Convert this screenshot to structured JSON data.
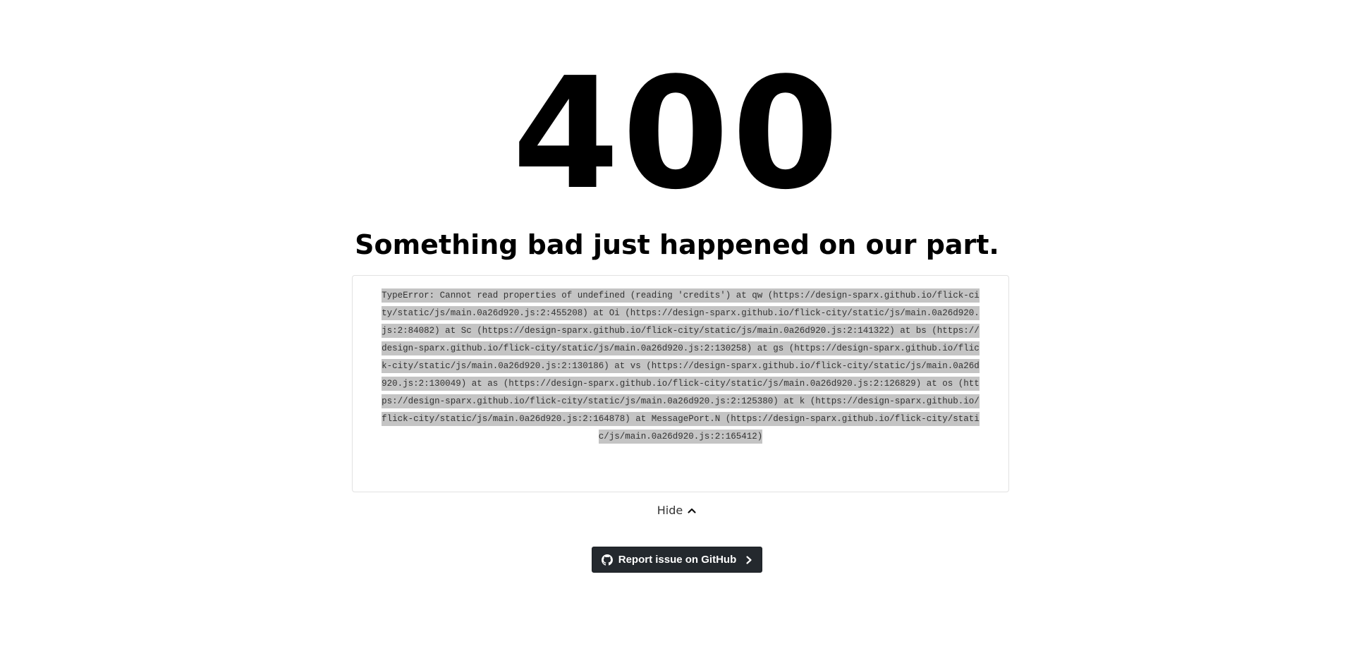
{
  "error_page": {
    "status_code": "400",
    "headline": "Something bad just happened on our part.",
    "error_details": "TypeError: Cannot read properties of undefined (reading 'credits') at qw (https://design-sparx.github.io/flick-city/static/js/main.0a26d920.js:2:455208) at Oi (https://design-sparx.github.io/flick-city/static/js/main.0a26d920.js:2:84082) at Sc (https://design-sparx.github.io/flick-city/static/js/main.0a26d920.js:2:141322) at bs (https://design-sparx.github.io/flick-city/static/js/main.0a26d920.js:2:130258) at gs (https://design-sparx.github.io/flick-city/static/js/main.0a26d920.js:2:130186) at vs (https://design-sparx.github.io/flick-city/static/js/main.0a26d920.js:2:130049) at as (https://design-sparx.github.io/flick-city/static/js/main.0a26d920.js:2:126829) at os (https://design-sparx.github.io/flick-city/static/js/main.0a26d920.js:2:125380) at k (https://design-sparx.github.io/flick-city/static/js/main.0a26d920.js:2:164878) at MessagePort.N (https://design-sparx.github.io/flick-city/static/js/main.0a26d920.js:2:165412)",
    "toggle_label": "Hide",
    "toggle_icon": "chevron-up-icon",
    "report_button_label": "Report issue on GitHub",
    "report_button_icon": "github-icon",
    "report_button_arrow_icon": "chevron-right-icon"
  },
  "colors": {
    "background": "#ffffff",
    "text": "#000000",
    "selection_highlight": "#c4c4c4",
    "button_background": "#24292e",
    "button_text": "#ffffff",
    "box_border": "#e2e2e2"
  }
}
